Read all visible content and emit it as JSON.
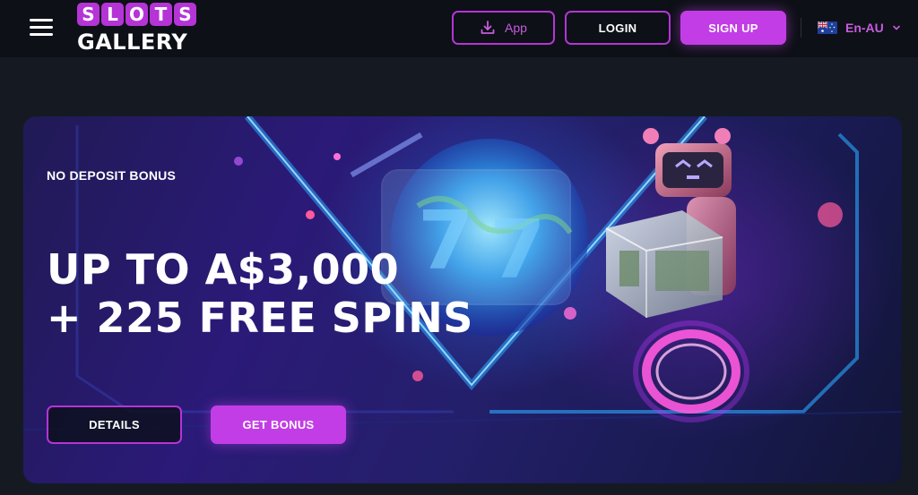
{
  "header": {
    "logo_top_letters": [
      "S",
      "L",
      "O",
      "T",
      "S"
    ],
    "logo_bottom": "GALLERY",
    "app_label": "App",
    "login_label": "LOGIN",
    "signup_label": "SIGN UP",
    "language_label": "En-AU"
  },
  "banner": {
    "eyebrow": "NO DEPOSIT BONUS",
    "headline_line1": "UP TO A$3,000",
    "headline_line2": "+ 225 FREE SPINS",
    "details_label": "DETAILS",
    "bonus_label": "GET BONUS"
  },
  "icons": {
    "menu": "hamburger-menu-icon",
    "app": "download-icon",
    "flag": "australia-flag-icon",
    "chevron": "chevron-down-icon"
  },
  "colors": {
    "accent": "#c23de6",
    "accent_border": "#b534d6",
    "header_bg": "#0d1016",
    "page_bg": "#151a22"
  }
}
